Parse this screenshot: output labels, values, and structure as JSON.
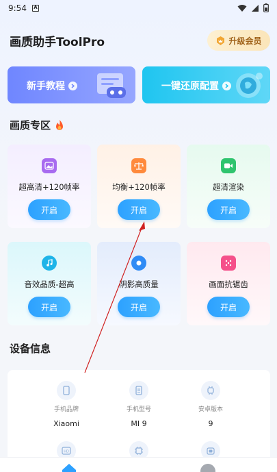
{
  "status_bar": {
    "time": "9:54",
    "notification": "A"
  },
  "header": {
    "title": "画质助手ToolPro",
    "upgrade_label": "升级会员"
  },
  "banners": [
    {
      "label": "新手教程",
      "color": "#6f86ff"
    },
    {
      "label": "一键还原配置",
      "color": "#1fc5f0"
    }
  ],
  "quality_section": {
    "title": "画质专区"
  },
  "quality_cards": [
    {
      "label": "超高清+120帧率",
      "button": "开启",
      "icon": "image-icon"
    },
    {
      "label": "均衡+120帧率",
      "button": "开启",
      "icon": "balance-icon"
    },
    {
      "label": "超清渲染",
      "button": "开启",
      "icon": "video-icon"
    },
    {
      "label": "音效品质-超高",
      "button": "开启",
      "icon": "music-icon"
    },
    {
      "label": "阴影高质量",
      "button": "开启",
      "icon": "shadow-icon"
    },
    {
      "label": "画面抗锯齿",
      "button": "开启",
      "icon": "dice-icon"
    }
  ],
  "device_section": {
    "title": "设备信息"
  },
  "device_info": [
    {
      "caption": "手机品牌",
      "value": "Xiaomi",
      "icon": "phone-icon"
    },
    {
      "caption": "手机型号",
      "value": "MI 9",
      "icon": "sim-icon"
    },
    {
      "caption": "安卓版本",
      "value": "9",
      "icon": "android-icon"
    }
  ],
  "colors": {
    "accent": "#2da1ff",
    "gold": "#a0621a",
    "fire": "#ff5a2a"
  }
}
